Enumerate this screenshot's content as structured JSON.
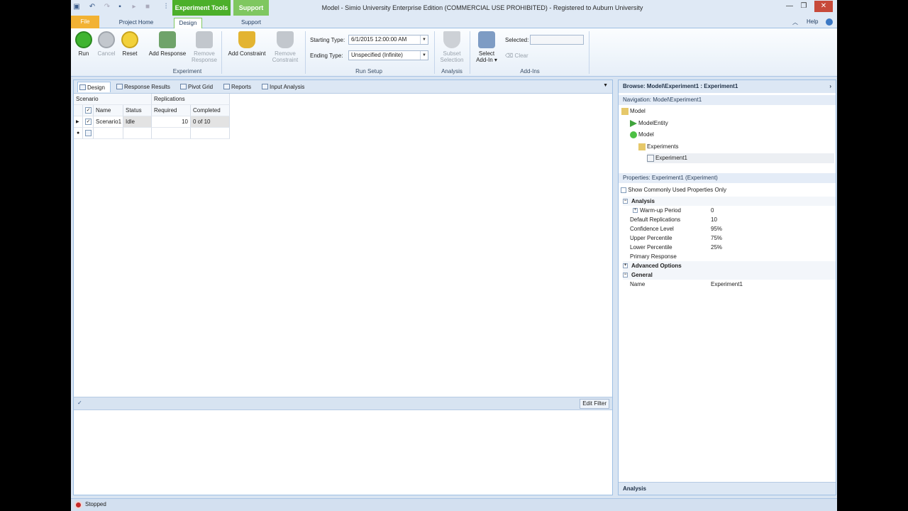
{
  "window": {
    "title": "Model - Simio University Enterprise Edition (COMMERCIAL USE PROHIBITED) - Registered to Auburn University",
    "context_group": "Experiment Tools",
    "context_support": "Support"
  },
  "tabs": {
    "file": "File",
    "project_home": "Project Home",
    "design": "Design",
    "support": "Support",
    "help": "Help"
  },
  "ribbon": {
    "run": "Run",
    "cancel": "Cancel",
    "reset": "Reset",
    "add_response": "Add Response",
    "remove_response_1": "Remove",
    "remove_response_2": "Response",
    "add_constraint": "Add Constraint",
    "remove_constraint_1": "Remove",
    "remove_constraint_2": "Constraint",
    "group_experiment": "Experiment",
    "starting_type_label": "Starting Type:",
    "starting_type_value": "6/1/2015 12:00:00 AM",
    "ending_type_label": "Ending Type:",
    "ending_type_value": "Unspecified (Infinite)",
    "group_run_setup": "Run Setup",
    "subset_1": "Subset",
    "subset_2": "Selection",
    "group_analysis": "Analysis",
    "select_addin_1": "Select",
    "select_addin_2": "Add-In",
    "selected_label": "Selected:",
    "selected_value": "",
    "clear": "Clear",
    "group_addins": "Add-Ins"
  },
  "subtabs": [
    "Design",
    "Response Results",
    "Pivot Grid",
    "Reports",
    "Input Analysis"
  ],
  "grid": {
    "group_scenario": "Scenario",
    "group_replications": "Replications",
    "col_name": "Name",
    "col_status": "Status",
    "col_required": "Required",
    "col_completed": "Completed",
    "rows": [
      {
        "name": "Scenario1",
        "status": "Idle",
        "required": "10",
        "completed": "0 of 10"
      }
    ]
  },
  "filter": {
    "edit_filter": "Edit Filter"
  },
  "browse": {
    "header": "Browse: Model\\Experiment1 : Experiment1",
    "navigation": "Navigation: Model\\Experiment1",
    "tree": [
      "Model",
      "ModelEntity",
      "Model",
      "Experiments",
      "Experiment1"
    ]
  },
  "properties": {
    "header": "Properties: Experiment1 (Experiment)",
    "show_common": "Show Commonly Used Properties Only",
    "cat_analysis": "Analysis",
    "rows": [
      {
        "k": "Warm-up Period",
        "v": "0"
      },
      {
        "k": "Default Replications",
        "v": "10"
      },
      {
        "k": "Confidence Level",
        "v": "95%"
      },
      {
        "k": "Upper Percentile",
        "v": "75%"
      },
      {
        "k": "Lower Percentile",
        "v": "25%"
      },
      {
        "k": "Primary Response",
        "v": ""
      }
    ],
    "cat_advanced": "Advanced Options",
    "cat_general": "General",
    "name_key": "Name",
    "name_value": "Experiment1",
    "footer": "Analysis"
  },
  "status": {
    "text": "Stopped"
  },
  "colors": {
    "accent_green": "#4caf2a",
    "file_orange": "#f2b233",
    "stop_red": "#c62a2a"
  }
}
